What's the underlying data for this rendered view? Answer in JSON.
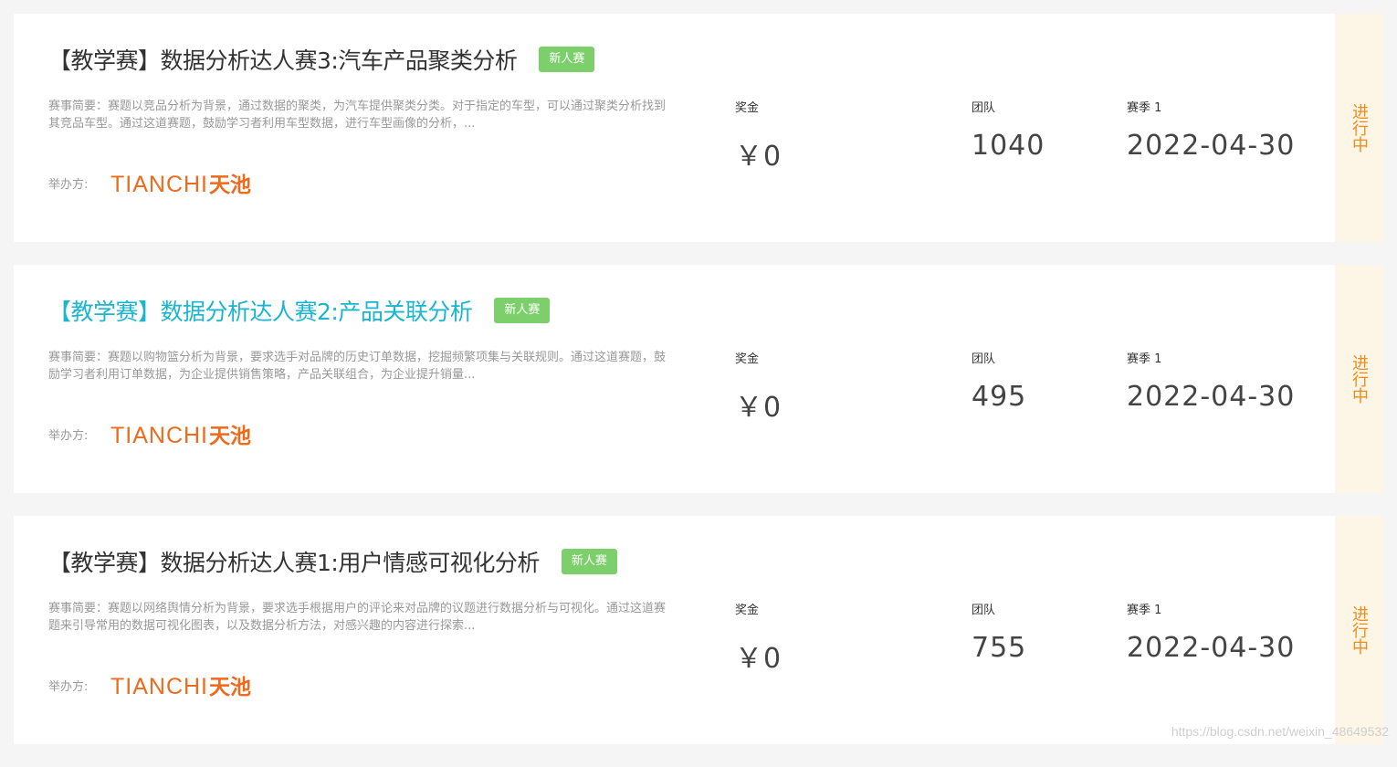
{
  "competitions": [
    {
      "title": "【教学赛】数据分析达人赛3:汽车产品聚类分析",
      "highlighted": false,
      "badge": "新人赛",
      "summary": "赛事简要：赛题以竞品分析为背景，通过数据的聚类，为汽车提供聚类分类。对于指定的车型，可以通过聚类分析找到其竞品车型。通过这道赛题，鼓励学习者利用车型数据，进行车型画像的分析，...",
      "organizer_label": "举办方:",
      "organizer_logo_en": "TIANCHI",
      "organizer_logo_cn": "天池",
      "prize_label": "奖金",
      "prize_value": "￥0",
      "team_label": "团队",
      "team_value": "1040",
      "season_label": "赛季 1",
      "season_value": "2022-04-30",
      "status": "进行中"
    },
    {
      "title": "【教学赛】数据分析达人赛2:产品关联分析",
      "highlighted": true,
      "badge": "新人赛",
      "summary": "赛事简要：赛题以购物篮分析为背景，要求选手对品牌的历史订单数据，挖掘频繁项集与关联规则。通过这道赛题，鼓励学习者利用订单数据，为企业提供销售策略，产品关联组合，为企业提升销量...",
      "organizer_label": "举办方:",
      "organizer_logo_en": "TIANCHI",
      "organizer_logo_cn": "天池",
      "prize_label": "奖金",
      "prize_value": "￥0",
      "team_label": "团队",
      "team_value": "495",
      "season_label": "赛季 1",
      "season_value": "2022-04-30",
      "status": "进行中"
    },
    {
      "title": "【教学赛】数据分析达人赛1:用户情感可视化分析",
      "highlighted": false,
      "badge": "新人赛",
      "summary": "赛事简要：赛题以网络舆情分析为背景，要求选手根据用户的评论来对品牌的议题进行数据分析与可视化。通过这道赛题来引导常用的数据可视化图表，以及数据分析方法，对感兴趣的内容进行探索...",
      "organizer_label": "举办方:",
      "organizer_logo_en": "TIANCHI",
      "organizer_logo_cn": "天池",
      "prize_label": "奖金",
      "prize_value": "￥0",
      "team_label": "团队",
      "team_value": "755",
      "season_label": "赛季 1",
      "season_value": "2022-04-30",
      "status": "进行中"
    }
  ],
  "watermark": "https://blog.csdn.net/weixin_48649532",
  "colors": {
    "title": "#333333",
    "title_highlight": "#1ab5d0",
    "badge": "#7ccf6a",
    "logo": "#ee6a1c",
    "status_text": "#f08c1c",
    "status_bg": "#fdf5e6"
  }
}
